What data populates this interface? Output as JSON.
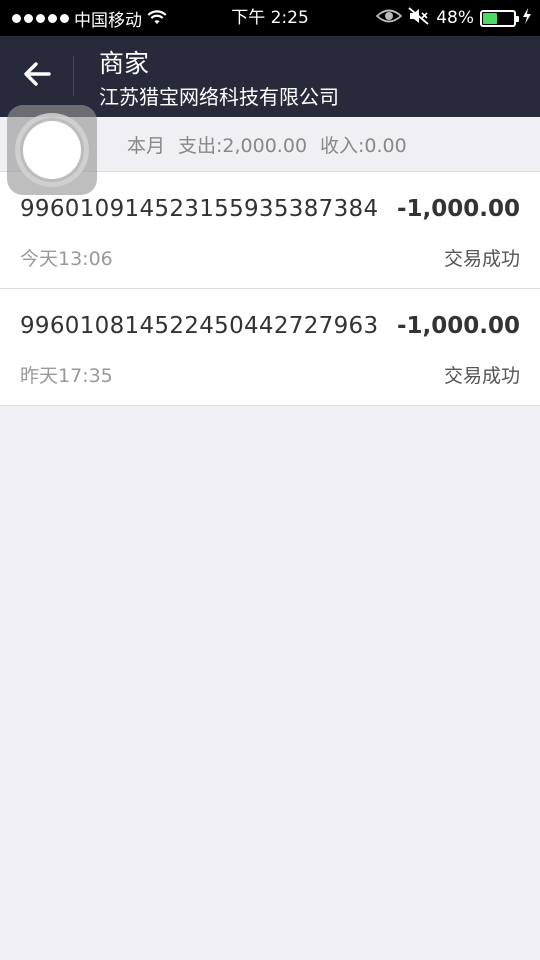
{
  "status_bar": {
    "carrier": "中国移动",
    "time": "下午 2:25",
    "battery_percent": "48%",
    "battery_level": 0.48,
    "battery_color": "#4cd964"
  },
  "nav": {
    "title": "商家",
    "subtitle": "江苏猎宝网络科技有限公司",
    "background": "#272a3b"
  },
  "summary": {
    "period": "本月",
    "expense": "支出:2,000.00",
    "income": "收入:0.00"
  },
  "transactions": [
    {
      "id": "996010914523155935387384",
      "amount": "-1,000.00",
      "time": "今天13:06",
      "status": "交易成功"
    },
    {
      "id": "996010814522450442727963",
      "amount": "-1,000.00",
      "time": "昨天17:35",
      "status": "交易成功"
    }
  ],
  "icons": {
    "signal": "signal-dots-icon",
    "wifi": "wifi-icon",
    "eye": "eye-icon",
    "mute": "mute-icon",
    "charging": "charging-bolt-icon",
    "back": "back-arrow-icon",
    "assistive_touch": "assistive-touch-icon"
  }
}
